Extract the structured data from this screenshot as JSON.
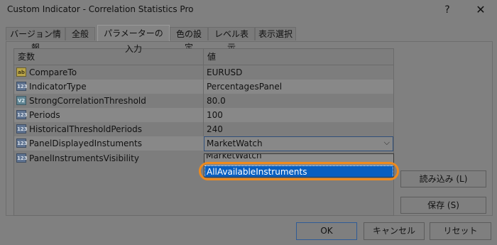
{
  "window": {
    "title": "Custom Indicator - Correlation Statistics Pro",
    "help_glyph": "?",
    "close_glyph": "✕"
  },
  "tabs": [
    {
      "label": "バージョン情報"
    },
    {
      "label": "全般"
    },
    {
      "label": "パラメーターの入力",
      "active": true
    },
    {
      "label": "色の設定"
    },
    {
      "label": "レベル表示"
    },
    {
      "label": "表示選択"
    }
  ],
  "grid": {
    "headers": {
      "variable": "変数",
      "value": "値"
    },
    "rows": [
      {
        "icon": "string-icon",
        "icon_text": "ab",
        "name": "CompareTo",
        "value": "EURUSD"
      },
      {
        "icon": "integer-icon",
        "icon_text": "123",
        "name": "IndicatorType",
        "value": "PercentagesPanel"
      },
      {
        "icon": "double-icon",
        "icon_text": "V2",
        "name": "StrongCorrelationThreshold",
        "value": "80.0"
      },
      {
        "icon": "integer-icon",
        "icon_text": "123",
        "name": "Periods",
        "value": "100"
      },
      {
        "icon": "integer-icon",
        "icon_text": "123",
        "name": "HistoricalThresholdPeriods",
        "value": "240"
      },
      {
        "icon": "integer-icon",
        "icon_text": "123",
        "name": "PanelDisplayedInstuments",
        "value": "MarketWatch"
      },
      {
        "icon": "integer-icon",
        "icon_text": "123",
        "name": "PanelInstrumentsVisibility",
        "value": ""
      }
    ]
  },
  "dropdown": {
    "selected_value": "MarketWatch",
    "arrow_glyph": "⌵",
    "options": [
      "MarketWatch",
      "AllAvailableInstruments"
    ],
    "highlighted": "AllAvailableInstruments",
    "highlight_color": "#f08a1c",
    "selection_color": "#0a5fc0"
  },
  "side_buttons": {
    "load": "読み込み (L)",
    "save": "保存 (S)"
  },
  "bottom_buttons": {
    "ok": "OK",
    "cancel": "キャンセル",
    "reset": "リセット"
  }
}
